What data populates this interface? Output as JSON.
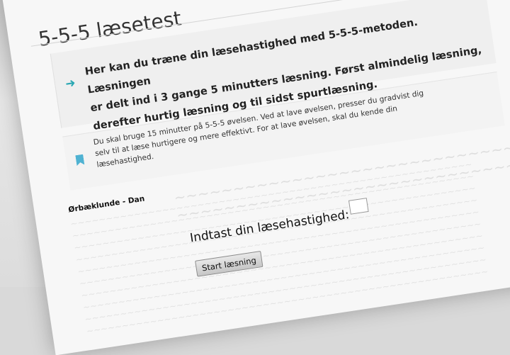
{
  "page": {
    "title": "5-5-5 læsetest",
    "accent_color": "#2aa7b3"
  },
  "intro": {
    "icon": "arrow-right-icon",
    "text": "Her kan du træne din læsehastighed med 5-5-5-metoden. Læsningen\ner delt ind i 3 gange 5 minutters læsning. Først almindelig læsning,\nderefter hurtig læsning og til sidst spurtlæsning."
  },
  "note": {
    "icon": "bookmark-icon",
    "text": "Du skal bruge 15 minutter på 5-5-5 øvelsen. Ved at lave øvelsen, presser du gradvist dig\nselv til at læse hurtigere og mere effektivt. For at lave øvelsen, skal du kende din\nlæsehastighed."
  },
  "reading": {
    "source_label": "Ørbæklunde - Dan"
  },
  "speed_form": {
    "label": "Indtast din læsehastighed:",
    "input_value": "",
    "button_label": "Start læsning"
  }
}
